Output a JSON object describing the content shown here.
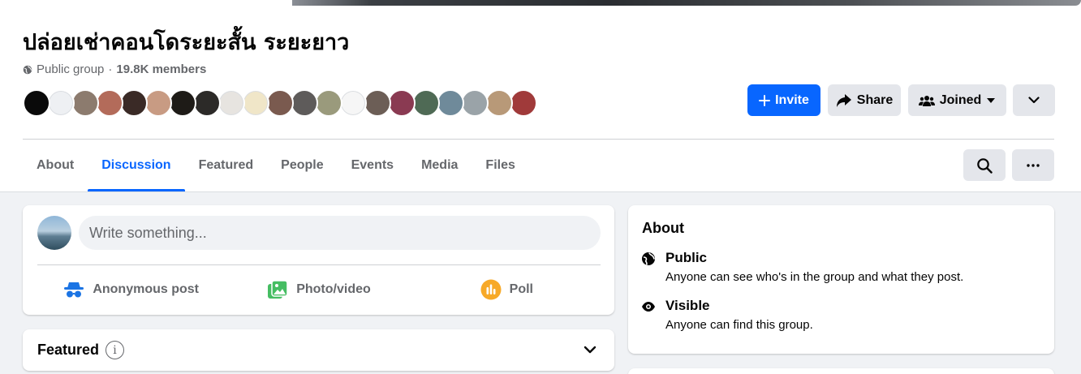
{
  "group": {
    "title": "ปล่อยเช่าคอนโดระยะสั้น ระยะยาว",
    "privacy": "Public group",
    "separator": "·",
    "members": "19.8K members"
  },
  "member_avatar_colors": [
    "#0a0a0a",
    "#eef0f3",
    "#8c7b6e",
    "#b36b5a",
    "#3a2a26",
    "#c89b83",
    "#1e1b17",
    "#2c2a28",
    "#e7e4e0",
    "#f0e6c8",
    "#7a5a4f",
    "#5e5b5a",
    "#9a9a7c",
    "#f6f6f6",
    "#6c5e56",
    "#8a3a52",
    "#4f6a55",
    "#6f8a9a",
    "#9aa3a8",
    "#b89978",
    "#a03a3a"
  ],
  "actions": {
    "invite": "Invite",
    "share": "Share",
    "joined": "Joined"
  },
  "tabs": [
    {
      "label": "About"
    },
    {
      "label": "Discussion",
      "active": true
    },
    {
      "label": "Featured"
    },
    {
      "label": "People"
    },
    {
      "label": "Events"
    },
    {
      "label": "Media"
    },
    {
      "label": "Files"
    }
  ],
  "composer": {
    "placeholder": "Write something...",
    "options": [
      {
        "label": "Anonymous post",
        "icon": "anonymous-icon",
        "color": "#1b74e4"
      },
      {
        "label": "Photo/video",
        "icon": "photo-icon",
        "color": "#45bd62"
      },
      {
        "label": "Poll",
        "icon": "poll-icon",
        "color": "#f7b928"
      }
    ]
  },
  "featured": {
    "label": "Featured",
    "info_glyph": "i"
  },
  "about": {
    "heading": "About",
    "items": [
      {
        "title": "Public",
        "desc": "Anyone can see who's in the group and what they post.",
        "icon": "globe-icon"
      },
      {
        "title": "Visible",
        "desc": "Anyone can find this group.",
        "icon": "eye-icon"
      }
    ]
  },
  "colors": {
    "accent": "#0866ff",
    "page_bg": "#f0f2f5",
    "secondary_button": "#e4e6eb",
    "muted_text": "#65676b"
  }
}
